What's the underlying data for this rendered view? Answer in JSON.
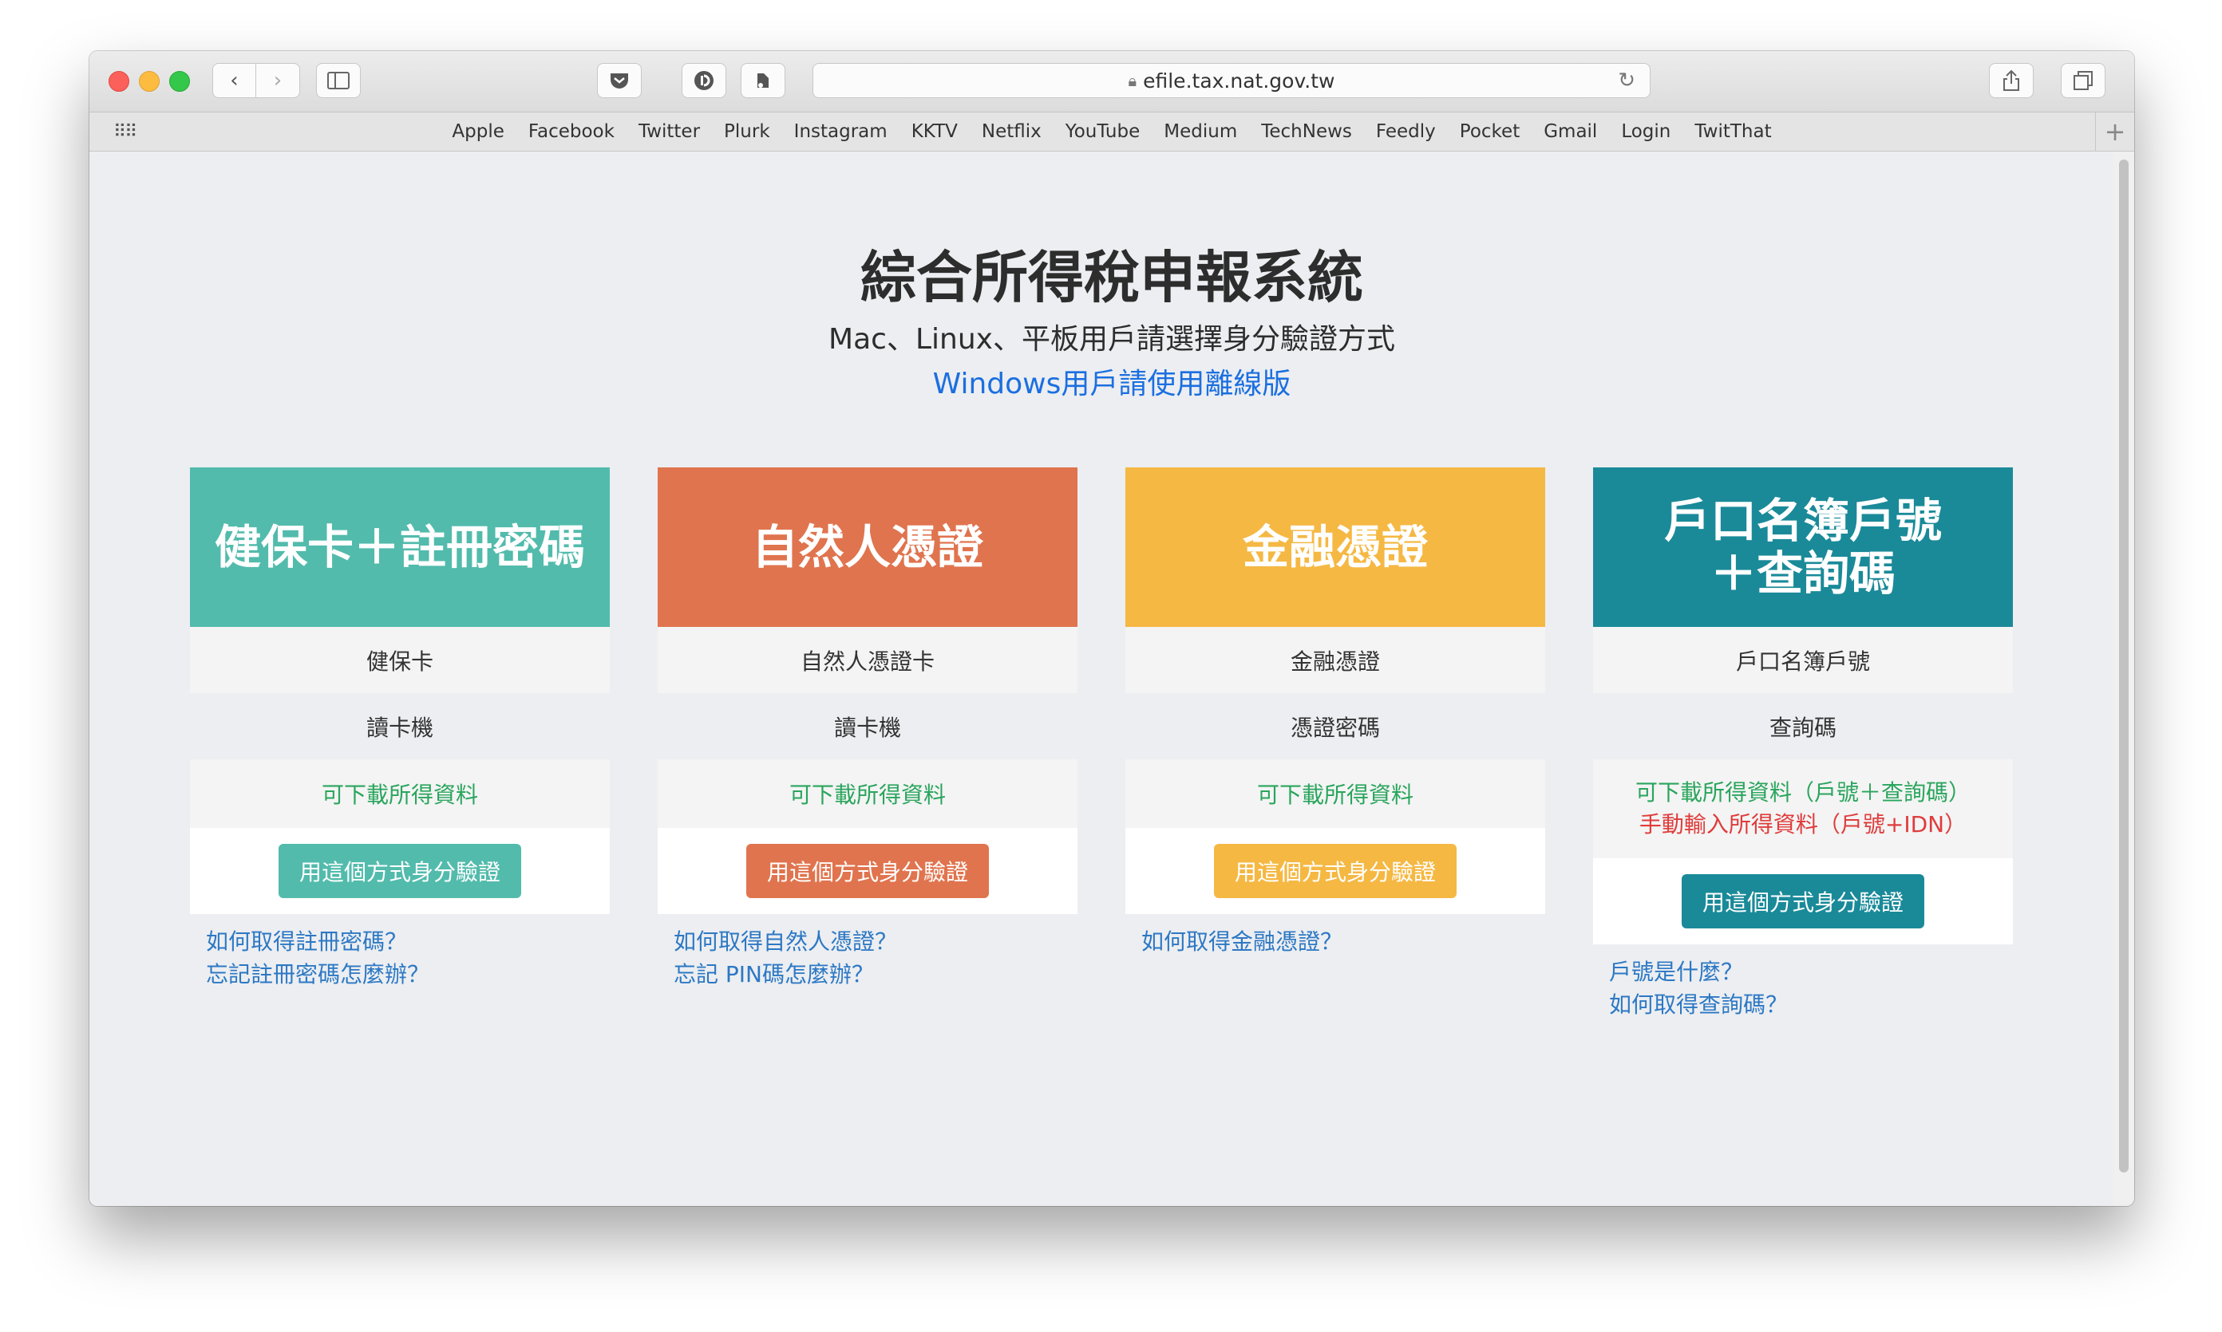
{
  "browser": {
    "url": "efile.tax.nat.gov.tw",
    "bookmarks": [
      "Apple",
      "Facebook",
      "Twitter",
      "Plurk",
      "Instagram",
      "KKTV",
      "Netflix",
      "YouTube",
      "Medium",
      "TechNews",
      "Feedly",
      "Pocket",
      "Gmail",
      "Login",
      "TwitThat"
    ]
  },
  "page": {
    "title": "綜合所得稅申報系統",
    "subtitle": "Mac、Linux、平板用戶請選擇身分驗證方式",
    "windows_link": "Windows用戶請使用離線版",
    "verify_label": "用這個方式身分驗證",
    "cards": [
      {
        "head": "健保卡＋註冊密碼",
        "item1": "健保卡",
        "item2": "讀卡機",
        "download": "可下載所得資料",
        "links": [
          "如何取得註冊密碼？",
          "忘記註冊密碼怎麼辦？"
        ]
      },
      {
        "head": "自然人憑證",
        "item1": "自然人憑證卡",
        "item2": "讀卡機",
        "download": "可下載所得資料",
        "links": [
          "如何取得自然人憑證？",
          "忘記 PIN碼怎麼辦？"
        ]
      },
      {
        "head": "金融憑證",
        "item1": "金融憑證",
        "item2": "憑證密碼",
        "download": "可下載所得資料",
        "links": [
          "如何取得金融憑證？"
        ]
      },
      {
        "head_line1": "戶口名簿戶號",
        "head_line2": "＋查詢碼",
        "item1": "戶口名簿戶號",
        "item2": "查詢碼",
        "download": "可下載所得資料（戶號＋查詢碼）",
        "manual": "手動輸入所得資料（戶號+IDN）",
        "links": [
          "戶號是什麼？",
          "如何取得查詢碼？"
        ]
      }
    ]
  },
  "colors": {
    "card1": "#52bbac",
    "card2": "#e0744e",
    "card3": "#f5b843",
    "card4": "#1a8a99",
    "link": "#2d78c4",
    "download": "#2aa55d",
    "manual": "#e03c3c"
  }
}
